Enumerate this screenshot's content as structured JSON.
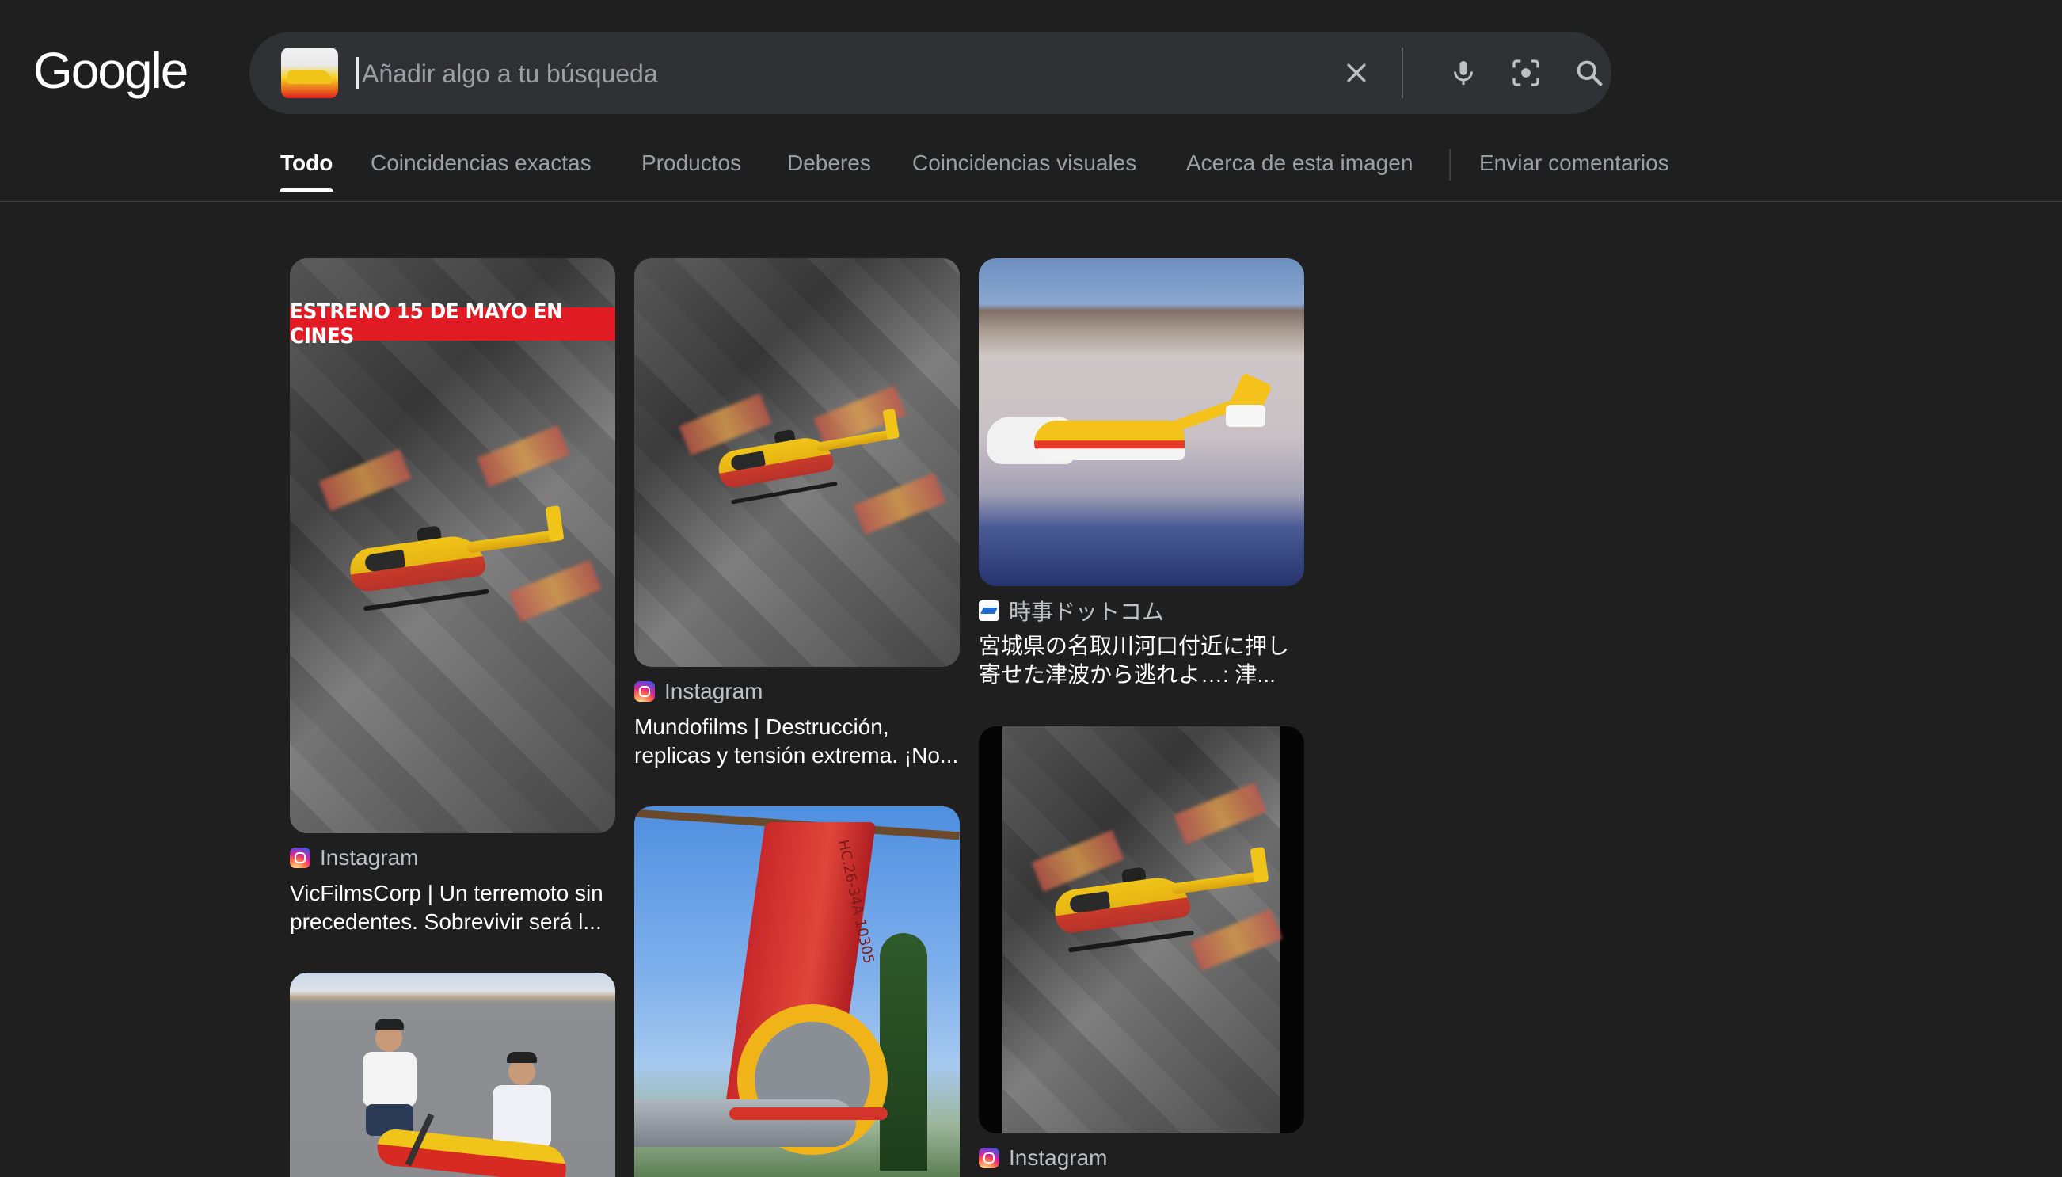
{
  "header": {
    "logo_text": "Google",
    "search": {
      "placeholder": "Añadir algo a tu búsqueda",
      "value": ""
    }
  },
  "icons": {
    "clear": "close-icon",
    "voice": "microphone-icon",
    "lens": "lens-camera-icon",
    "search": "search-icon"
  },
  "tabs": [
    {
      "label": "Todo",
      "active": true
    },
    {
      "label": "Coincidencias exactas"
    },
    {
      "label": "Productos"
    },
    {
      "label": "Deberes"
    },
    {
      "label": "Coincidencias visuales"
    },
    {
      "label": "Acerca de esta imagen"
    },
    {
      "label": "Enviar comentarios"
    }
  ],
  "results": [
    {
      "source": "Instagram",
      "banner": "ESTRENO 15 DE MAYO EN CINES",
      "title": "VicFilmsCorp | Un terremoto sin precedentes. Sobrevivir será l..."
    },
    {
      "source": "Instagram",
      "title": "Mundofilms | Destrucción, replicas y tensión extrema. ¡No..."
    },
    {
      "source": "時事ドットコム",
      "title": "宮城県の名取川河口付近に押し寄せた津波から逃れよ…: 津..."
    },
    {
      "source": "Instagram",
      "title": ""
    },
    {
      "source": "",
      "title": ""
    },
    {
      "source": "",
      "image_text": "HC.26-34A 10305",
      "title": ""
    }
  ],
  "colors": {
    "background": "#1f1f1f",
    "search_bar": "#303134",
    "text_primary": "#ffffff",
    "text_secondary": "#9aa0a6"
  }
}
